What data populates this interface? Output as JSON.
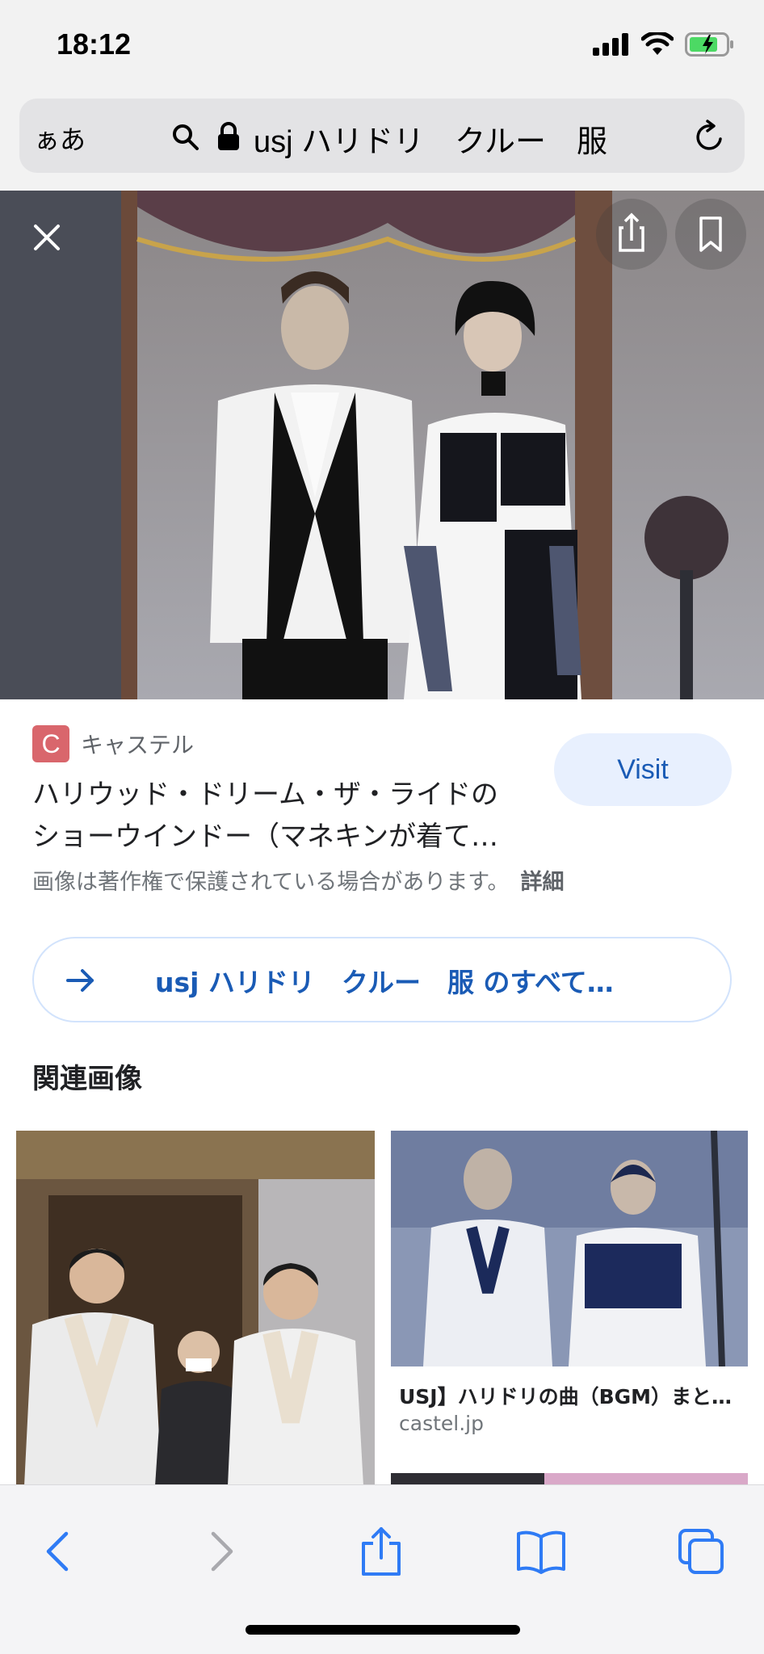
{
  "status_bar": {
    "time": "18:12"
  },
  "address_bar": {
    "aa_label": "ぁあ",
    "url": "usj ハリドリ　クルー　服",
    "icons": [
      "search-icon",
      "lock-icon",
      "reload-icon"
    ]
  },
  "image_viewer": {
    "icons": [
      "close-icon",
      "share-icon",
      "bookmark-icon"
    ]
  },
  "result": {
    "source_logo_letter": "C",
    "source_name": "キャステル",
    "title_line1": "ハリウッド・ドリーム・ザ・ライドの",
    "title_line2": "ショーウインドー（マネキンが着て…",
    "visit_label": "Visit",
    "copyright_notice": "画像は著作権で保護されている場合があります。",
    "details_label": "詳細"
  },
  "see_all": {
    "label": "usj ハリドリ　クルー　服 のすべて…"
  },
  "related": {
    "heading": "関連画像",
    "items": [
      {
        "title": "",
        "source": ""
      },
      {
        "title": "USJ】ハリドリの曲（BGM）まと…",
        "source": "castel.jp"
      }
    ]
  },
  "toolbar": {
    "buttons": [
      "back-icon",
      "forward-icon",
      "share-icon",
      "bookmarks-icon",
      "tabs-icon"
    ]
  },
  "colors": {
    "accent": "#1a5bb5",
    "visit_bg": "#e8f0fe",
    "source_logo": "#d9666c",
    "toolbar_icons": "#2f7bf5"
  }
}
